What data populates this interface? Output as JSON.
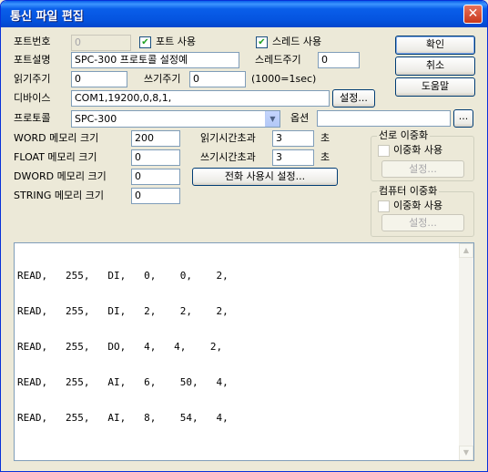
{
  "window": {
    "title": "통신 파일 편집",
    "close_glyph": "✕"
  },
  "fields": {
    "port_number_label": "포트번호",
    "port_number_value": "0",
    "port_use_label": "포트 사용",
    "thread_use_label": "스레드 사용",
    "port_desc_label": "포트설명",
    "port_desc_value": "SPC-300 프로토콜 설정예",
    "thread_cycle_label": "스레드주기",
    "thread_cycle_value": "0",
    "read_cycle_label": "읽기주기",
    "read_cycle_value": "0",
    "write_cycle_label": "쓰기주기",
    "write_cycle_value": "0",
    "cycle_unit": "(1000=1sec)",
    "device_label": "디바이스",
    "device_value": "COM1,19200,0,8,1,",
    "device_setup": "설정...",
    "protocol_label": "프로토콜",
    "protocol_value": "SPC-300",
    "option_label": "옵션",
    "option_value": "",
    "option_button": "...",
    "word_label": "WORD 메모리 크기",
    "word_value": "200",
    "float_label": "FLOAT 메모리 크기",
    "float_value": "0",
    "dword_label": "DWORD 메모리 크기",
    "dword_value": "0",
    "string_label": "STRING 메모리 크기",
    "string_value": "0",
    "read_timeout_label": "읽기시간초과",
    "read_timeout_value": "3",
    "write_timeout_label": "쓰기시간초과",
    "write_timeout_value": "3",
    "seconds": "초",
    "phone_setup": "전화 사용시 설정..."
  },
  "buttons": {
    "ok": "확인",
    "cancel": "취소",
    "help": "도움말"
  },
  "line_redundancy": {
    "title": "선로 이중화",
    "check_label": "이중화 사용",
    "setup": "설정..."
  },
  "pc_redundancy": {
    "title": "컴퓨터 이중화",
    "check_label": "이중화 사용",
    "setup": "설정..."
  },
  "checks": {
    "port_use": "✔",
    "thread_use": "✔"
  },
  "memo": {
    "lines": [
      "READ,   255,   DI,   0,    0,    2,",
      "READ,   255,   DI,   2,    2,    2,",
      "READ,   255,   DO,   4,   4,    2,",
      "READ,   255,   AI,   6,    50,   4,",
      "READ,   255,   AI,   8,    54,   4,"
    ]
  },
  "scroll": {
    "up": "▲",
    "down": "▼"
  },
  "combo_arrow": "▼"
}
